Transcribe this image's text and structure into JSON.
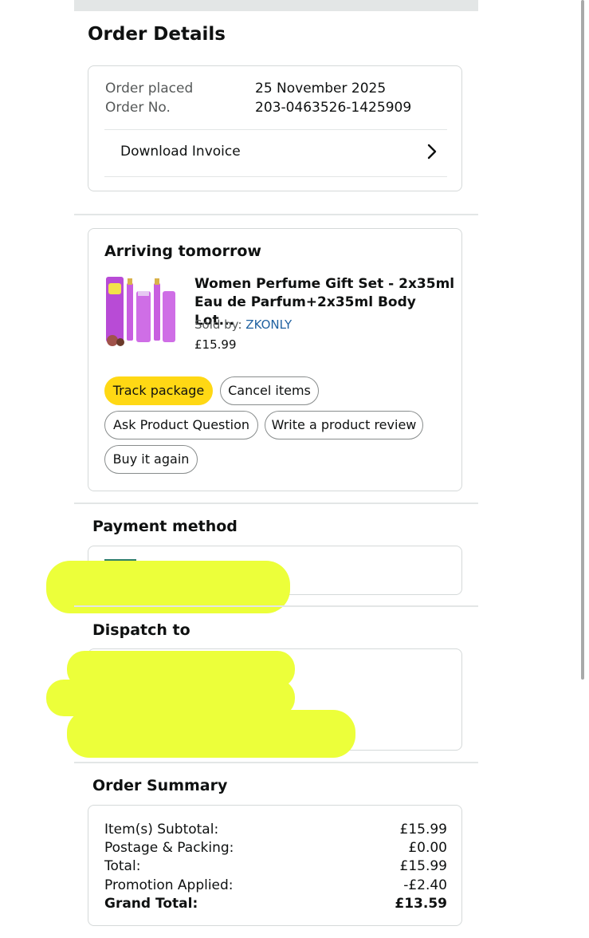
{
  "order_details": {
    "title": "Order Details",
    "placed_label": "Order placed",
    "placed_value": "25 November 2025",
    "number_label": "Order No.",
    "number_value": "203-0463526-1425909",
    "invoice_label": "Download Invoice"
  },
  "shipment": {
    "status": "Arriving tomorrow",
    "product_title_line1": "Women Perfume Gift Set - 2x35ml",
    "product_title_line2": "Eau de Parfum+2x35ml Body Lot...",
    "sold_by_label": "Sold by: ",
    "seller": "ZKONLY",
    "price": "£15.99",
    "buttons": {
      "track": "Track package",
      "cancel": "Cancel items",
      "ask": "Ask Product Question",
      "review": "Write a product review",
      "buy_again": "Buy it again"
    }
  },
  "payment": {
    "title": "Payment method"
  },
  "dispatch": {
    "title": "Dispatch to"
  },
  "summary": {
    "title": "Order Summary",
    "rows": [
      {
        "label": "Item(s) Subtotal:",
        "value": "£15.99"
      },
      {
        "label": "Postage & Packing:",
        "value": "£0.00"
      },
      {
        "label": "Total:",
        "value": "£15.99"
      },
      {
        "label": "Promotion Applied:",
        "value": "-£2.40"
      },
      {
        "label": "Grand Total:",
        "value": "£13.59"
      }
    ]
  },
  "colors": {
    "primary_button": "#ffd814",
    "link": "#2162a1",
    "redaction": "#ecff3a"
  },
  "icons": [
    "chevron-right-icon",
    "product-thumbnail"
  ]
}
